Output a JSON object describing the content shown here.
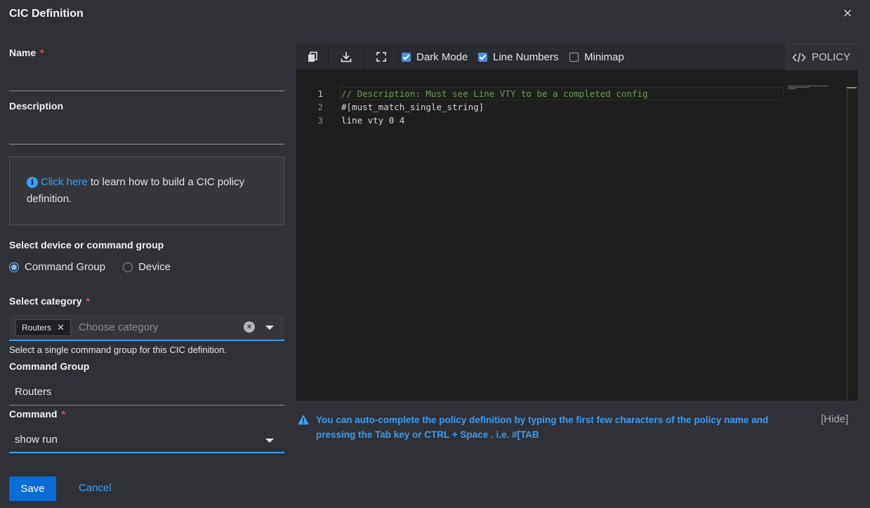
{
  "dialog": {
    "title": "CIC Definition"
  },
  "form": {
    "name_label": "Name",
    "required_mark": "*",
    "name_value": "",
    "description_label": "Description",
    "description_value": "",
    "info": {
      "link_text": "Click here",
      "text": " to learn how to build a CIC policy definition."
    },
    "group_label": "Select device or command group",
    "radio_options": [
      {
        "label": "Command Group",
        "selected": true
      },
      {
        "label": "Device",
        "selected": false
      }
    ],
    "category_label": "Select category",
    "category_chip": "Routers",
    "category_placeholder": "Choose category",
    "category_helper": "Select a single command group for this CIC definition.",
    "command_group_label": "Command Group",
    "command_group_value": "Routers",
    "command_label": "Command",
    "command_value": "show run",
    "save_label": "Save",
    "cancel_label": "Cancel"
  },
  "editor": {
    "toolbar": {
      "copy_icon": "copy-icon",
      "download_icon": "download-icon",
      "fullscreen_icon": "fullscreen-icon",
      "options": [
        {
          "label": "Dark Mode",
          "checked": true
        },
        {
          "label": "Line Numbers",
          "checked": true
        },
        {
          "label": "Minimap",
          "checked": false
        }
      ],
      "policy_tab": "POLICY"
    },
    "lines": [
      {
        "num": "1",
        "text": "// Description: Must see Line VTY to be a completed config",
        "kind": "comment"
      },
      {
        "num": "2",
        "text": "#[must_match_single_string]",
        "kind": "code"
      },
      {
        "num": "3",
        "text": "line vty 0 4",
        "kind": "code"
      }
    ]
  },
  "notice": {
    "text": "You can auto-complete the policy definition by typing the first few characters of the policy name and pressing the Tab key or CTRL + Space . i.e. #[TAB",
    "hide_label": "[Hide]"
  },
  "colors": {
    "accent": "#3d9cf0",
    "primary_button": "#0a6cd6",
    "required": "#e05555",
    "background": "#303136",
    "editor_bg": "#1e1e1e"
  }
}
